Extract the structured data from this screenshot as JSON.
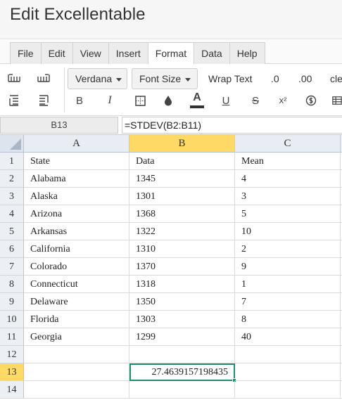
{
  "app": {
    "title": "Edit Excellentable"
  },
  "menu": {
    "tabs": [
      {
        "label": "File"
      },
      {
        "label": "Edit"
      },
      {
        "label": "View"
      },
      {
        "label": "Insert"
      },
      {
        "label": "Format",
        "active": true
      },
      {
        "label": "Data"
      },
      {
        "label": "Help"
      }
    ]
  },
  "toolbar": {
    "font_family": "Verdana",
    "font_size": "Font Size",
    "wrap_text": "Wrap Text",
    "decrease_decimal": ".0",
    "increase_decimal": ".00",
    "clear": "cle",
    "bold": "B",
    "italic": "I",
    "font_color_glyph": "A",
    "underline": "U",
    "strikethrough": "S",
    "superscript": "x²"
  },
  "formula_bar": {
    "cell_ref": "B13",
    "formula": "=STDEV(B2:B11)"
  },
  "grid": {
    "columns": [
      "A",
      "B",
      "C"
    ],
    "selected_column": "B",
    "selected_row": "13",
    "rows": [
      {
        "num": "1",
        "a": "State",
        "b": "Data",
        "c": "Mean"
      },
      {
        "num": "2",
        "a": "Alabama",
        "b": "1345",
        "c": "4"
      },
      {
        "num": "3",
        "a": "Alaska",
        "b": "1301",
        "c": "3"
      },
      {
        "num": "4",
        "a": "Arizona",
        "b": "1368",
        "c": "5"
      },
      {
        "num": "5",
        "a": "Arkansas",
        "b": "1322",
        "c": "10"
      },
      {
        "num": "6",
        "a": "California",
        "b": "1310",
        "c": "2"
      },
      {
        "num": "7",
        "a": "Colorado",
        "b": "1370",
        "c": "9"
      },
      {
        "num": "8",
        "a": "Connecticut",
        "b": "1318",
        "c": "1"
      },
      {
        "num": "9",
        "a": "Delaware",
        "b": "1350",
        "c": "7"
      },
      {
        "num": "10",
        "a": "Florida",
        "b": "1303",
        "c": "8"
      },
      {
        "num": "11",
        "a": "Georgia",
        "b": "1299",
        "c": "40"
      },
      {
        "num": "12",
        "a": "",
        "b": "",
        "c": ""
      },
      {
        "num": "13",
        "a": "",
        "b": "27.4639157198435",
        "c": ""
      },
      {
        "num": "14",
        "a": "",
        "b": "",
        "c": ""
      }
    ]
  },
  "colors": {
    "selection_border": "#1d8f6b",
    "selected_header": "#ffd966"
  }
}
